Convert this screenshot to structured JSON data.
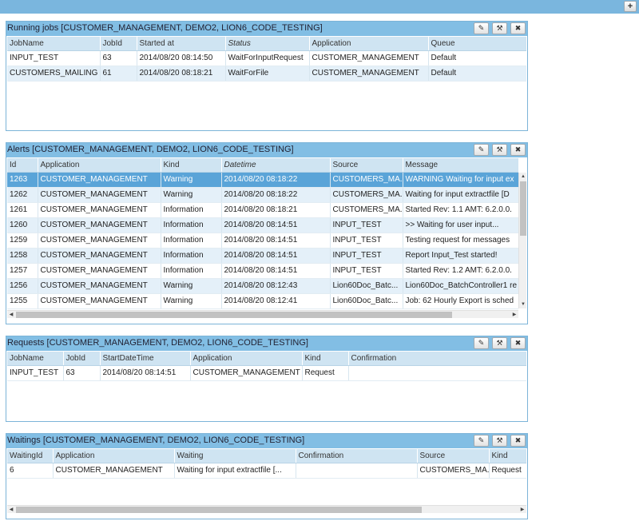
{
  "topbar": {
    "add_icon": "plus-icon",
    "add_glyph": "+"
  },
  "widget_buttons": {
    "edit_glyph": "✎",
    "settings_glyph": "⚒",
    "close_glyph": "✖"
  },
  "running_jobs": {
    "title": "Running jobs [CUSTOMER_MANAGEMENT, DEMO2, LION6_CODE_TESTING]",
    "columns": [
      "JobName",
      "JobId",
      "Started at",
      "Status",
      "Application",
      "Queue"
    ],
    "rows": [
      [
        "INPUT_TEST",
        "63",
        "2014/08/20 08:14:50",
        "WaitForInputRequest",
        "CUSTOMER_MANAGEMENT",
        "Default"
      ],
      [
        "CUSTOMERS_MAILING",
        "61",
        "2014/08/20 08:18:21",
        "WaitForFile",
        "CUSTOMER_MANAGEMENT",
        "Default"
      ]
    ]
  },
  "alerts": {
    "title": "Alerts [CUSTOMER_MANAGEMENT, DEMO2, LION6_CODE_TESTING]",
    "columns": [
      "Id",
      "Application",
      "Kind",
      "Datetime",
      "Source",
      "Message"
    ],
    "rows": [
      [
        "1263",
        "CUSTOMER_MANAGEMENT",
        "Warning",
        "2014/08/20 08:18:22",
        "CUSTOMERS_MA...",
        "WARNING Waiting for input ex"
      ],
      [
        "1262",
        "CUSTOMER_MANAGEMENT",
        "Warning",
        "2014/08/20 08:18:22",
        "CUSTOMERS_MA...",
        "Waiting for input extractfile [D"
      ],
      [
        "1261",
        "CUSTOMER_MANAGEMENT",
        "Information",
        "2014/08/20 08:18:21",
        "CUSTOMERS_MA...",
        "Started Rev: 1.1 AMT: 6.2.0.0."
      ],
      [
        "1260",
        "CUSTOMER_MANAGEMENT",
        "Information",
        "2014/08/20 08:14:51",
        "INPUT_TEST",
        ">> Waiting for user input..."
      ],
      [
        "1259",
        "CUSTOMER_MANAGEMENT",
        "Information",
        "2014/08/20 08:14:51",
        "INPUT_TEST",
        "Testing request for messages"
      ],
      [
        "1258",
        "CUSTOMER_MANAGEMENT",
        "Information",
        "2014/08/20 08:14:51",
        "INPUT_TEST",
        "Report Input_Test started!"
      ],
      [
        "1257",
        "CUSTOMER_MANAGEMENT",
        "Information",
        "2014/08/20 08:14:51",
        "INPUT_TEST",
        "Started Rev: 1.2 AMT: 6.2.0.0."
      ],
      [
        "1256",
        "CUSTOMER_MANAGEMENT",
        "Warning",
        "2014/08/20 08:12:43",
        "Lion60Doc_Batc...",
        "Lion60Doc_BatchController1 re"
      ],
      [
        "1255",
        "CUSTOMER_MANAGEMENT",
        "Warning",
        "2014/08/20 08:12:41",
        "Lion60Doc_Batc...",
        "Job: 62 Hourly Export is sched"
      ]
    ]
  },
  "requests": {
    "title": "Requests [CUSTOMER_MANAGEMENT, DEMO2, LION6_CODE_TESTING]",
    "columns": [
      "JobName",
      "JobId",
      "StartDateTime",
      "Application",
      "Kind",
      "Confirmation"
    ],
    "rows": [
      [
        "INPUT_TEST",
        "63",
        "2014/08/20 08:14:51",
        "CUSTOMER_MANAGEMENT",
        "Request",
        ""
      ]
    ]
  },
  "waitings": {
    "title": "Waitings [CUSTOMER_MANAGEMENT, DEMO2, LION6_CODE_TESTING]",
    "columns": [
      "WaitingId",
      "Application",
      "Waiting",
      "Confirmation",
      "Source",
      "Kind"
    ],
    "rows": [
      [
        "6",
        "CUSTOMER_MANAGEMENT",
        "Waiting for input extractfile [...",
        "",
        "CUSTOMERS_MA...",
        "Request"
      ]
    ]
  },
  "colors": {
    "header_bar": "#7ab6de",
    "widget_header": "#82bee4",
    "selected_row": "#5aa4d8",
    "alt_row": "#e4f0f9"
  }
}
